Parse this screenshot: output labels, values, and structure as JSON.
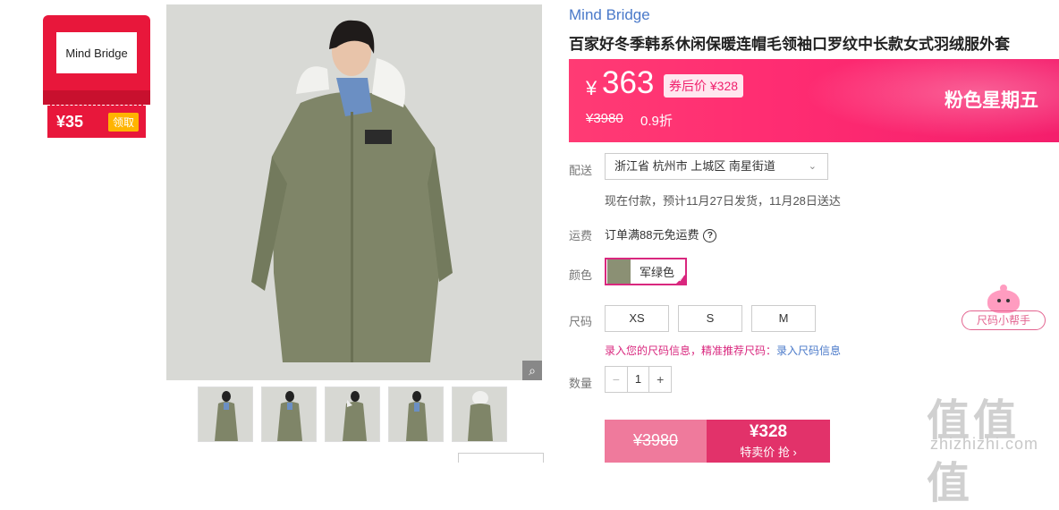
{
  "coupon": {
    "brand_logo": "Mind Bridge",
    "amount": "¥35",
    "claim_label": "领取"
  },
  "gallery": {
    "main_image_alt": "woman in army green hooded long down coat",
    "zoom_icon": "magnifier-icon",
    "thumbnail_count": 5
  },
  "product": {
    "brand": "Mind Bridge",
    "title": "百家好冬季韩系休闲保暖连帽毛领袖口罗纹中长款女式羽绒服外套"
  },
  "price_band": {
    "yen": "¥",
    "price": "363",
    "coupon_price": "券后价 ¥328",
    "original_price": "¥3980",
    "discount": "0.9折",
    "event": "粉色星期五"
  },
  "delivery": {
    "label": "配送",
    "address": "浙江省 杭州市 上城区 南星街道",
    "note": "现在付款，预计11月27日发货，11月28日送达"
  },
  "freight": {
    "label": "运费",
    "text": "订单满88元免运费",
    "help": "?"
  },
  "color": {
    "label": "颜色",
    "option": "军绿色",
    "swatch_color": "#8b9074",
    "check": "✓"
  },
  "size": {
    "label": "尺码",
    "options": [
      "XS",
      "S",
      "M"
    ],
    "hint": "录入您的尺码信息，精准推荐尺码：",
    "hint_link": "录入尺码信息",
    "helper": "尺码小帮手"
  },
  "quantity": {
    "label": "数量",
    "minus": "−",
    "value": "1",
    "plus": "+"
  },
  "buy": {
    "original": "¥3980",
    "price": "¥328",
    "label": "特卖价 抢 ›"
  },
  "watermark": {
    "logo": "值值值",
    "site": "zhizhizhi.com"
  },
  "colors": {
    "accent": "#e2326a",
    "band": "#ff2d72",
    "link": "#4a79c9"
  }
}
